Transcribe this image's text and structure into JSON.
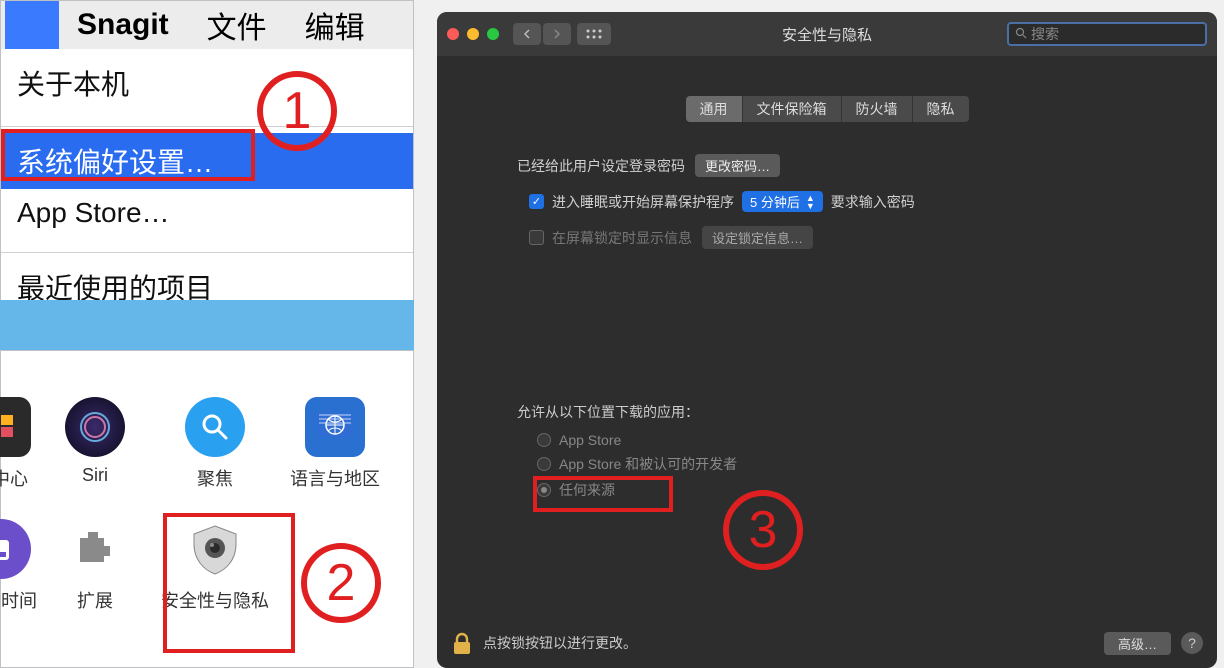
{
  "panel1": {
    "menubar": {
      "app": "Snagit",
      "file": "文件",
      "edit": "编辑"
    },
    "menu": {
      "about": "关于本机",
      "sysprefs": "系统偏好设置…",
      "appstore": "App Store…",
      "recent": "最近使用的项目"
    }
  },
  "annotations": {
    "step1": "1",
    "step2": "2",
    "step3": "3"
  },
  "panel2": {
    "row1": [
      {
        "label": "屏中心"
      },
      {
        "label": "Siri"
      },
      {
        "label": "聚焦"
      },
      {
        "label": "语言与地区"
      }
    ],
    "row2": [
      {
        "label": "屏用时间"
      },
      {
        "label": "扩展"
      },
      {
        "label": "安全性与隐私"
      }
    ]
  },
  "panel3": {
    "title": "安全性与隐私",
    "search_placeholder": "搜索",
    "tabs": {
      "general": "通用",
      "filevault": "文件保险箱",
      "firewall": "防火墙",
      "privacy": "隐私"
    },
    "login_set": "已经给此用户设定登录密码",
    "change_pw": "更改密码…",
    "sleep_label_pre": "进入睡眠或开始屏幕保护程序",
    "sleep_select": "5 分钟后",
    "sleep_label_post": "要求输入密码",
    "show_msg": "在屏幕锁定时显示信息",
    "set_lock_msg": "设定锁定信息…",
    "gatekeeper_hdr": "允许从以下位置下载的应用：",
    "gk_appstore": "App Store",
    "gk_identified": "App Store 和被认可的开发者",
    "gk_anywhere": "任何来源",
    "lock_text": "点按锁按钮以进行更改。",
    "advanced": "高级…",
    "help": "?"
  }
}
